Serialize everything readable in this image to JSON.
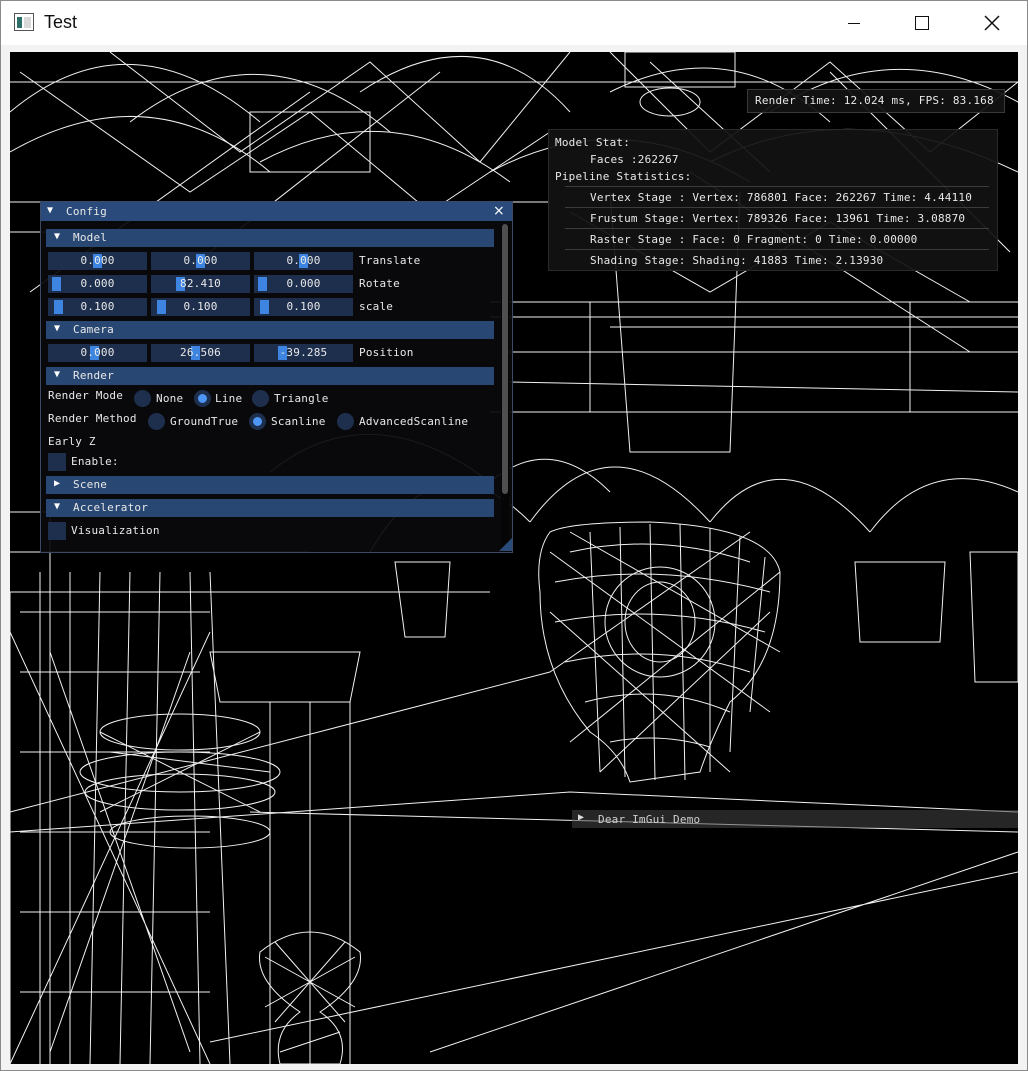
{
  "window": {
    "title": "Test",
    "icon": "app-window-icon",
    "controls": [
      "minimize-icon",
      "maximize-icon",
      "close-icon"
    ]
  },
  "overlay": {
    "render_time": "Render Time: 12.024 ms, FPS: 83.168"
  },
  "stats": {
    "model_stat": "Model Stat:",
    "faces": "Faces    :262267",
    "pipeline": "Pipeline Statistics:",
    "vertex_stage": "Vertex Stage :  Vertex: 786801 Face: 262267 Time: 4.44110",
    "frustum_stage": "Frustum Stage: Vertex: 789326 Face: 13961 Time: 3.08870",
    "raster_stage": "Raster Stage : Face: 0 Fragment: 0 Time: 0.00000",
    "shading_stage": "Shading Stage: Shading: 41883 Time: 2.13930"
  },
  "config": {
    "title": "Config",
    "close": "×",
    "model": {
      "header": "Model",
      "translate": {
        "x": "0.000",
        "y": "0.000",
        "z": "0.000",
        "label": "Translate"
      },
      "rotate": {
        "x": "0.000",
        "y": "82.410",
        "z": "0.000",
        "label": "Rotate"
      },
      "scale": {
        "x": "0.100",
        "y": "0.100",
        "z": "0.100",
        "label": "scale"
      }
    },
    "camera": {
      "header": "Camera",
      "position": {
        "x": "0.000",
        "y": "26.506",
        "z": "-39.285",
        "label": "Position"
      }
    },
    "render": {
      "header": "Render",
      "mode_label": "Render Mode",
      "mode_options": [
        "None",
        "Line",
        "Triangle"
      ],
      "mode_selected": "Line",
      "method_label": "Render Method",
      "method_options": [
        "GroundTrue",
        "Scanline",
        "AdvancedScanline"
      ],
      "method_selected": "Scanline",
      "early_z_label": "Early Z",
      "enable_label": "Enable:",
      "enable_checked": false
    },
    "scene": {
      "header": "Scene",
      "collapsed": true
    },
    "accelerator": {
      "header": "Accelerator",
      "visualization_label": "Visualization",
      "visualization_checked": false
    }
  },
  "demo_window": {
    "title": "Dear ImGui Demo",
    "collapsed": true
  },
  "colors": {
    "viewport_bg": "#000000",
    "wire": "#ffffff",
    "imgui_header": "#284772",
    "imgui_frame": "#1d2f4d",
    "imgui_accent": "#4d96f5"
  }
}
